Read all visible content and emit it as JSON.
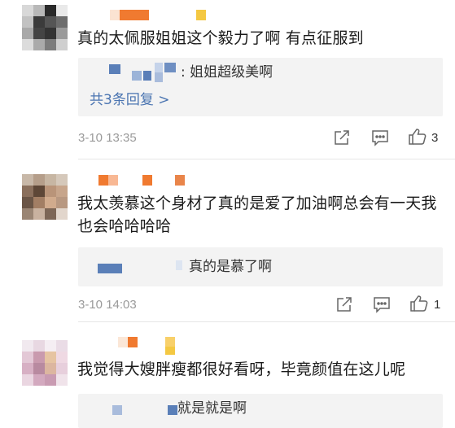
{
  "comments": [
    {
      "text": "真的太佩服姐姐这个毅力了啊 有点征服到",
      "replies": [
        {
          "text": ": 姐姐超级美啊"
        }
      ],
      "more_replies": "共3条回复 >",
      "time": "3-10 13:35",
      "likes": "3"
    },
    {
      "text": "我太羡慕这个身材了真的是爱了加油啊总会有一天我也会哈哈哈哈",
      "replies": [
        {
          "text": "真的是慕了啊"
        }
      ],
      "time": "3-10 14:03",
      "likes": "1"
    },
    {
      "text": "我觉得大嫂胖瘦都很好看呀，毕竟颜值在这儿呢",
      "replies": [
        {
          "text": "就是就是啊"
        }
      ]
    }
  ],
  "icons": {
    "share": "share-icon",
    "comment": "comment-icon",
    "like": "thumbs-up-icon"
  },
  "colors": {
    "link": "#4a74b1",
    "time": "#9a9a9a",
    "reply_bg": "#f3f3f3",
    "mosaic_orange": "#f07a30",
    "mosaic_yellow": "#f4c842",
    "mosaic_blue": "#5a7fb8"
  }
}
